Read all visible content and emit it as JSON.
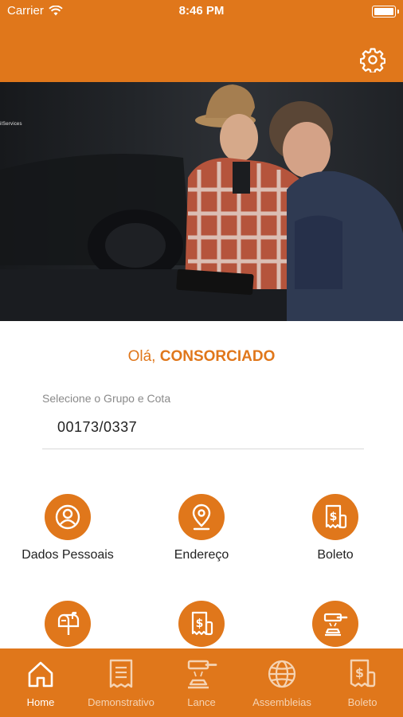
{
  "status_bar": {
    "carrier": "Carrier",
    "time": "8:46 PM"
  },
  "header": {
    "settings_icon": "gear-icon"
  },
  "banner": {
    "brand_text": "ilServices"
  },
  "greeting": {
    "prefix": "Olá,",
    "name": "CONSORCIADO"
  },
  "group_select": {
    "label": "Selecione o Grupo e Cota",
    "value": "00173/0337"
  },
  "grid": {
    "items": [
      {
        "label": "Dados Pessoais",
        "icon": "person-icon"
      },
      {
        "label": "Endereço",
        "icon": "location-pin-icon"
      },
      {
        "label": "Boleto",
        "icon": "dollar-receipt-icon"
      },
      {
        "label": "",
        "icon": "mailbox-icon"
      },
      {
        "label": "",
        "icon": "dollar-document-icon"
      },
      {
        "label": "",
        "icon": "gavel-icon"
      }
    ]
  },
  "tabbar": {
    "tabs": [
      {
        "label": "Home",
        "icon": "home-icon",
        "active": true
      },
      {
        "label": "Demonstrativo",
        "icon": "receipt-icon",
        "active": false
      },
      {
        "label": "Lance",
        "icon": "gavel-icon",
        "active": false
      },
      {
        "label": "Assembleias",
        "icon": "globe-icon",
        "active": false
      },
      {
        "label": "Boleto",
        "icon": "dollar-receipt-icon",
        "active": false
      }
    ]
  },
  "colors": {
    "brand": "#E0771B",
    "text": "#222222",
    "muted": "#8a8a8a"
  }
}
